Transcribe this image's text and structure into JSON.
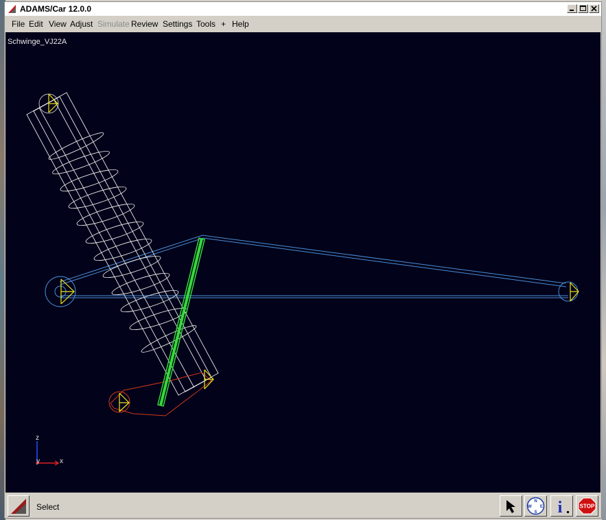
{
  "window": {
    "title": "ADAMS/Car 12.0.0"
  },
  "menu": {
    "items": [
      {
        "label": "File",
        "enabled": true
      },
      {
        "label": "Edit",
        "enabled": true
      },
      {
        "label": "View",
        "enabled": true
      },
      {
        "label": "Adjust",
        "enabled": true
      },
      {
        "label": "Simulate",
        "enabled": false
      },
      {
        "label": "Review",
        "enabled": true
      },
      {
        "label": "Settings",
        "enabled": true
      },
      {
        "label": "Tools",
        "enabled": true
      },
      {
        "label": "+",
        "enabled": true
      },
      {
        "label": "Help",
        "enabled": true
      }
    ]
  },
  "viewport": {
    "model_name": "Schwinge_VJ22A",
    "background_color": "#02021a",
    "triad": {
      "z": "z",
      "y": "y",
      "x": "x"
    }
  },
  "status": {
    "text": "Select"
  },
  "toolbar": {
    "select_icon": "arrow-cursor-icon",
    "view_icon": "compass-icon",
    "compass_letters": {
      "n": "N",
      "w": "W",
      "e": "E",
      "s": "S"
    },
    "info_icon": "info-icon",
    "info_label": "i",
    "stop_icon": "stop-icon",
    "stop_label": "STOP"
  },
  "colors": {
    "spring": "#e8e8e8",
    "link": "#4a8fd8",
    "damper": "#36d93a",
    "lower_link": "#d23a1a",
    "marker": "#f2e81c"
  }
}
